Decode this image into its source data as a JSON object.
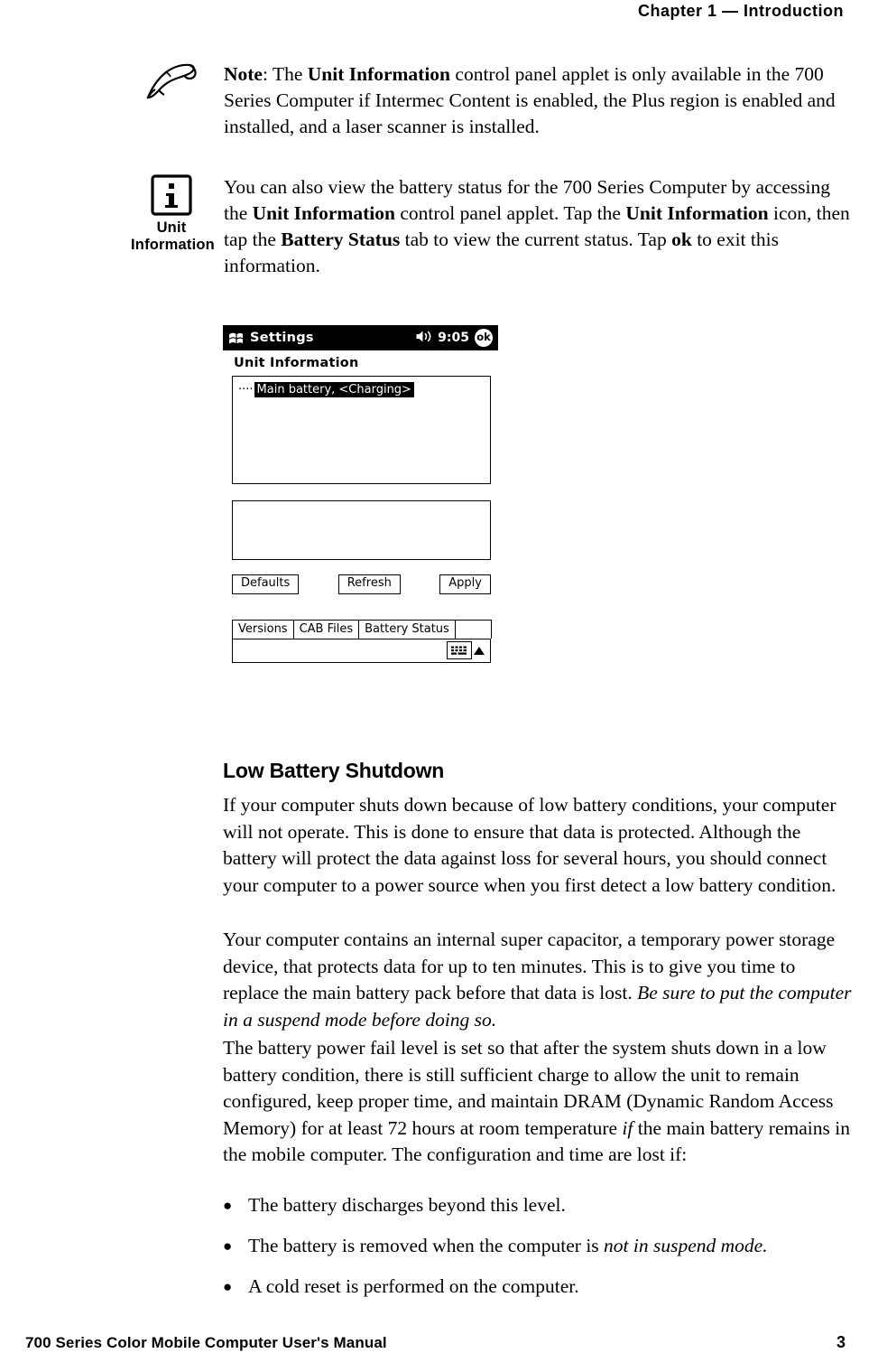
{
  "header": {
    "chapter": "Chapter  1  —  Introduction"
  },
  "notes": [
    {
      "icon": "pencil-note-icon",
      "caption": "",
      "lines": [
        "Note: The Unit Information control panel applet is only available in the",
        "700 Series Computer if Intermec Content is enabled, the Plus region is",
        "enabled and installed, and a laser scanner is installed."
      ]
    },
    {
      "icon": "info-icon",
      "caption": "Unit\nInformation",
      "caption_line1": "Unit",
      "caption_line2": "Information",
      "lines": [
        "You can also view the battery status for the 700 Series Computer by",
        "accessing the Unit Information control panel applet. Tap the Unit",
        "Information icon, then tap the Battery Status tab to view the current",
        "status. Tap ok to exit this information."
      ]
    }
  ],
  "pda": {
    "start_icon": "windows-start-icon",
    "title": "Settings",
    "speaker_icon": "speaker-icon",
    "clock": "9:05",
    "ok_label": "ok",
    "heading": "Unit Information",
    "tree_item": "Main battery, <Charging>",
    "buttons": [
      {
        "label": "Defaults",
        "name": "defaults-button"
      },
      {
        "label": "Refresh",
        "name": "refresh-button"
      },
      {
        "label": "Apply",
        "name": "apply-button"
      }
    ],
    "tabs": [
      {
        "label": "Versions",
        "name": "tab-versions"
      },
      {
        "label": "CAB Files",
        "name": "tab-cab-files"
      },
      {
        "label": "Battery Status",
        "name": "tab-battery-status"
      }
    ],
    "status_icons": {
      "keyboard": "keyboard-icon",
      "arrow": "chevron-up-icon"
    }
  },
  "section": {
    "title": "Low Battery Shutdown",
    "paragraphs": [
      "If your computer shuts down because of low battery conditions, your computer will not operate. This is done to ensure that data is protected. Although the battery will protect the data against loss for several hours, you should connect your computer to a power source when you first detect a low battery condition.",
      "Your computer contains an internal super capacitor, a temporary power storage device, that protects data for up to ten minutes. This is to give you time to replace the main battery pack before that data is lost. Be sure to put the computer in a suspend mode before doing so.",
      "The battery power fail level is set so that after the system shuts down in a low battery condition, there is still sufficient charge to allow the unit to remain configured, keep proper time, and maintain DRAM (Dynamic Random Access Memory) for at least 72 hours at room temperature if the main battery remains in the mobile computer. The configuration and time are lost if:"
    ],
    "bullets": [
      "The battery discharges beyond this level.",
      "The battery is removed when the computer is not in suspend mode.",
      "A cold reset is performed on the computer."
    ]
  },
  "footer": {
    "manual": "700 Series Color Mobile Computer User's Manual",
    "page": "3"
  }
}
